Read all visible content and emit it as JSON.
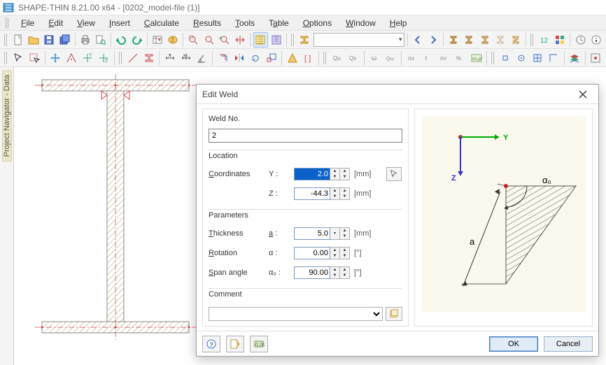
{
  "app": {
    "title": "SHAPE-THIN 8.21.00 x64 - [0202_model-file (1)]"
  },
  "menu": {
    "items": [
      {
        "label": "File",
        "accel": "F"
      },
      {
        "label": "Edit",
        "accel": "E"
      },
      {
        "label": "View",
        "accel": "V"
      },
      {
        "label": "Insert",
        "accel": "I"
      },
      {
        "label": "Calculate",
        "accel": "C"
      },
      {
        "label": "Results",
        "accel": "R"
      },
      {
        "label": "Tools",
        "accel": "T"
      },
      {
        "label": "Table",
        "accel": "a"
      },
      {
        "label": "Options",
        "accel": "O"
      },
      {
        "label": "Window",
        "accel": "W"
      },
      {
        "label": "Help",
        "accel": "H"
      }
    ]
  },
  "sidebar": {
    "label": "Project Navigator - Data"
  },
  "dialog": {
    "title": "Edit Weld",
    "groups": {
      "weldno": {
        "heading": "Weld No.",
        "value": "2"
      },
      "location": {
        "heading": "Location",
        "coord_label": "Coordinates",
        "y_sym": "Y :",
        "y_val": "2.0",
        "y_unit": "[mm]",
        "z_sym": "Z :",
        "z_val": "-44.3",
        "z_unit": "[mm]"
      },
      "params": {
        "heading": "Parameters",
        "thick_label": "Thickness",
        "thick_sym": "a :",
        "thick_val": "5.0",
        "thick_unit": "[mm]",
        "rot_label": "Rotation",
        "rot_sym": "α :",
        "rot_val": "0.00",
        "rot_unit": "[°]",
        "span_label": "Span angle",
        "span_sym": "α₀ :",
        "span_val": "90.00",
        "span_unit": "[°]"
      },
      "comment": {
        "heading": "Comment",
        "value": ""
      }
    },
    "diagram": {
      "y": "Y",
      "z": "Z",
      "a": "a",
      "alpha0": "α₀"
    },
    "buttons": {
      "ok": "OK",
      "cancel": "Cancel"
    }
  }
}
